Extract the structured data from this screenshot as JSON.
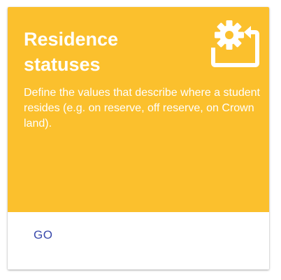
{
  "card": {
    "title": "Residence statuses",
    "description": "Define the values that describe where a student resides (e.g. on reserve, off reserve, on Crown land).",
    "icon": "settings-backup-restore-icon",
    "action_label": "GO"
  },
  "colors": {
    "header_background": "#fbc02d",
    "header_text": "#ffffff",
    "action_text": "#3949ab",
    "card_background": "#ffffff"
  }
}
